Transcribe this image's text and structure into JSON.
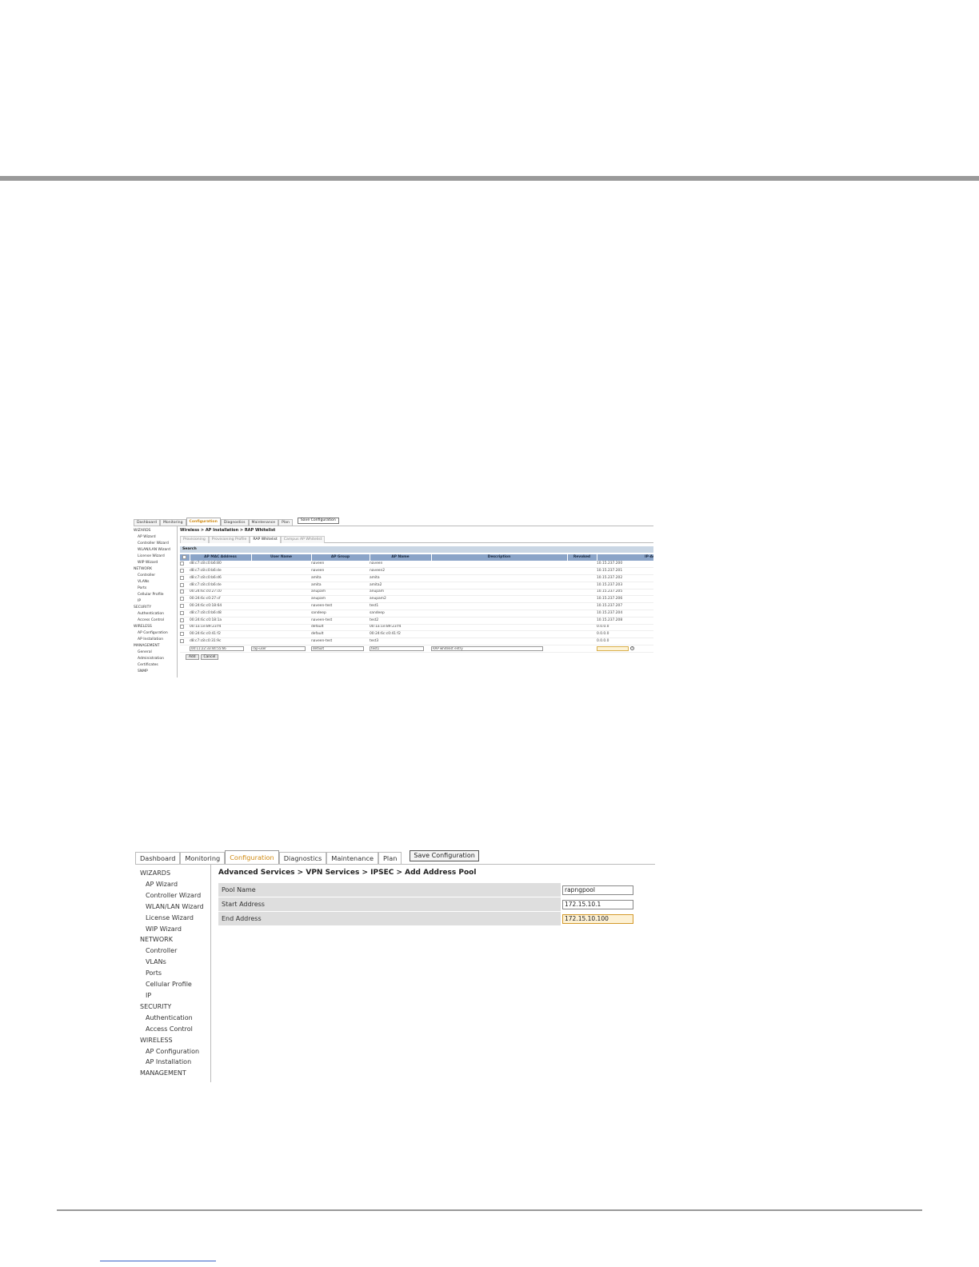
{
  "shot1": {
    "tabs": [
      "Dashboard",
      "Monitoring",
      "Configuration",
      "Diagnostics",
      "Maintenance",
      "Plan"
    ],
    "save_label": "Save Configuration",
    "sidebar": [
      {
        "label": "WIZARDS",
        "kind": "sec"
      },
      {
        "label": "AP Wizard",
        "kind": "itm"
      },
      {
        "label": "Controller Wizard",
        "kind": "itm"
      },
      {
        "label": "WLAN/LAN Wizard",
        "kind": "itm"
      },
      {
        "label": "License Wizard",
        "kind": "itm"
      },
      {
        "label": "WIP Wizard",
        "kind": "itm"
      },
      {
        "label": "NETWORK",
        "kind": "sec"
      },
      {
        "label": "Controller",
        "kind": "itm"
      },
      {
        "label": "VLANs",
        "kind": "itm"
      },
      {
        "label": "Ports",
        "kind": "itm"
      },
      {
        "label": "Cellular Profile",
        "kind": "itm"
      },
      {
        "label": "IP",
        "kind": "itm"
      },
      {
        "label": "SECURITY",
        "kind": "sec"
      },
      {
        "label": "Authentication",
        "kind": "itm"
      },
      {
        "label": "Access Control",
        "kind": "itm"
      },
      {
        "label": "WIRELESS",
        "kind": "sec"
      },
      {
        "label": "AP Configuration",
        "kind": "itm"
      },
      {
        "label": "AP Installation",
        "kind": "itm"
      },
      {
        "label": "MANAGEMENT",
        "kind": "sec"
      },
      {
        "label": "General",
        "kind": "itm"
      },
      {
        "label": "Administration",
        "kind": "itm"
      },
      {
        "label": "Certificates",
        "kind": "itm"
      },
      {
        "label": "SNMP",
        "kind": "itm"
      }
    ],
    "breadcrumb": "Wireless > AP Installation > RAP Whitelist",
    "subtabs": [
      "Provisioning",
      "Provisioning Profile",
      "RAP Whitelist",
      "Campus AP Whitelist"
    ],
    "search_label": "Search",
    "columns": [
      "AP MAC Address",
      "User Name",
      "AP Group",
      "AP Name",
      "Description",
      "Revoked",
      "IP-Addr"
    ],
    "rows": [
      [
        "d8:c7:c8:c0:b6:80",
        "",
        "naveen",
        "naveen",
        "",
        "",
        "10.15.237.200"
      ],
      [
        "d8:c7:c8:c0:b6:de",
        "",
        "naveen",
        "naveen2",
        "",
        "",
        "10.15.237.201"
      ],
      [
        "d8:c7:c8:c0:b6:d6",
        "",
        "amita",
        "amita",
        "",
        "",
        "10.15.237.202"
      ],
      [
        "d8:c7:c8:c0:b6:de",
        "",
        "amita",
        "amita2",
        "",
        "",
        "10.15.237.203"
      ],
      [
        "00:24:6c:c0:27:c0",
        "",
        "anupam",
        "anupam",
        "",
        "",
        "10.15.237.205"
      ],
      [
        "00:24:6c:c0:27:cf",
        "",
        "anupam",
        "anupam2",
        "",
        "",
        "10.15.237.206"
      ],
      [
        "00:24:6c:c0:18:64",
        "",
        "naveen-test",
        "test1",
        "",
        "",
        "10.15.237.207"
      ],
      [
        "d8:c7:c8:c0:b6:d8",
        "",
        "sandeep",
        "sandeep",
        "",
        "",
        "10.15.237.204"
      ],
      [
        "00:24:6c:c0:18:1a",
        "",
        "naveen-test",
        "test2",
        "",
        "",
        "10.15.237.208"
      ],
      [
        "00:1a:1e:89:23:f4",
        "",
        "default",
        "00:1a:1e:89:23:f4",
        "",
        "",
        "0.0.0.0"
      ],
      [
        "00:24:6c:c0:41:f2",
        "",
        "default",
        "00:24:6c:c0:41:f2",
        "",
        "",
        "0.0.0.0"
      ],
      [
        "d8:c7:c8:c0:31:9c",
        "",
        "naveen-test",
        "test3",
        "",
        "",
        "0.0.0.0"
      ]
    ],
    "new_row": {
      "mac": "00:11:22:33:44:55:66",
      "user": "rap-user",
      "group": "default",
      "name": "test1",
      "description": "RAP whitelist entry",
      "ip": ""
    },
    "add_label": "Add",
    "cancel_label": "Cancel"
  },
  "shot2": {
    "tabs": [
      "Dashboard",
      "Monitoring",
      "Configuration",
      "Diagnostics",
      "Maintenance",
      "Plan"
    ],
    "save_label": "Save Configuration",
    "sidebar": [
      {
        "label": "WIZARDS",
        "kind": "sec"
      },
      {
        "label": "AP Wizard",
        "kind": "itm"
      },
      {
        "label": "Controller Wizard",
        "kind": "itm"
      },
      {
        "label": "WLAN/LAN Wizard",
        "kind": "itm"
      },
      {
        "label": "License Wizard",
        "kind": "itm"
      },
      {
        "label": "WIP Wizard",
        "kind": "itm"
      },
      {
        "label": "NETWORK",
        "kind": "sec"
      },
      {
        "label": "Controller",
        "kind": "itm"
      },
      {
        "label": "VLANs",
        "kind": "itm"
      },
      {
        "label": "Ports",
        "kind": "itm"
      },
      {
        "label": "Cellular Profile",
        "kind": "itm"
      },
      {
        "label": "IP",
        "kind": "itm"
      },
      {
        "label": "SECURITY",
        "kind": "sec"
      },
      {
        "label": "Authentication",
        "kind": "itm"
      },
      {
        "label": "Access Control",
        "kind": "itm"
      },
      {
        "label": "WIRELESS",
        "kind": "sec"
      },
      {
        "label": "AP Configuration",
        "kind": "itm"
      },
      {
        "label": "AP Installation",
        "kind": "itm"
      },
      {
        "label": "MANAGEMENT",
        "kind": "sec"
      }
    ],
    "breadcrumb": "Advanced Services > VPN Services > IPSEC > Add Address Pool",
    "form": [
      {
        "label": "Pool Name",
        "value": "rapngpool"
      },
      {
        "label": "Start Address",
        "value": "172.15.10.1"
      },
      {
        "label": "End Address",
        "value": "172.15.10.100"
      }
    ]
  },
  "colors": {
    "active_tab": "#d08a12",
    "table_header": "#8aa4c8",
    "search_bar": "#c9d6e4",
    "form_row": "#dedede",
    "highlight_input": "#fdf1d4",
    "rule": "#9a9a9a"
  }
}
